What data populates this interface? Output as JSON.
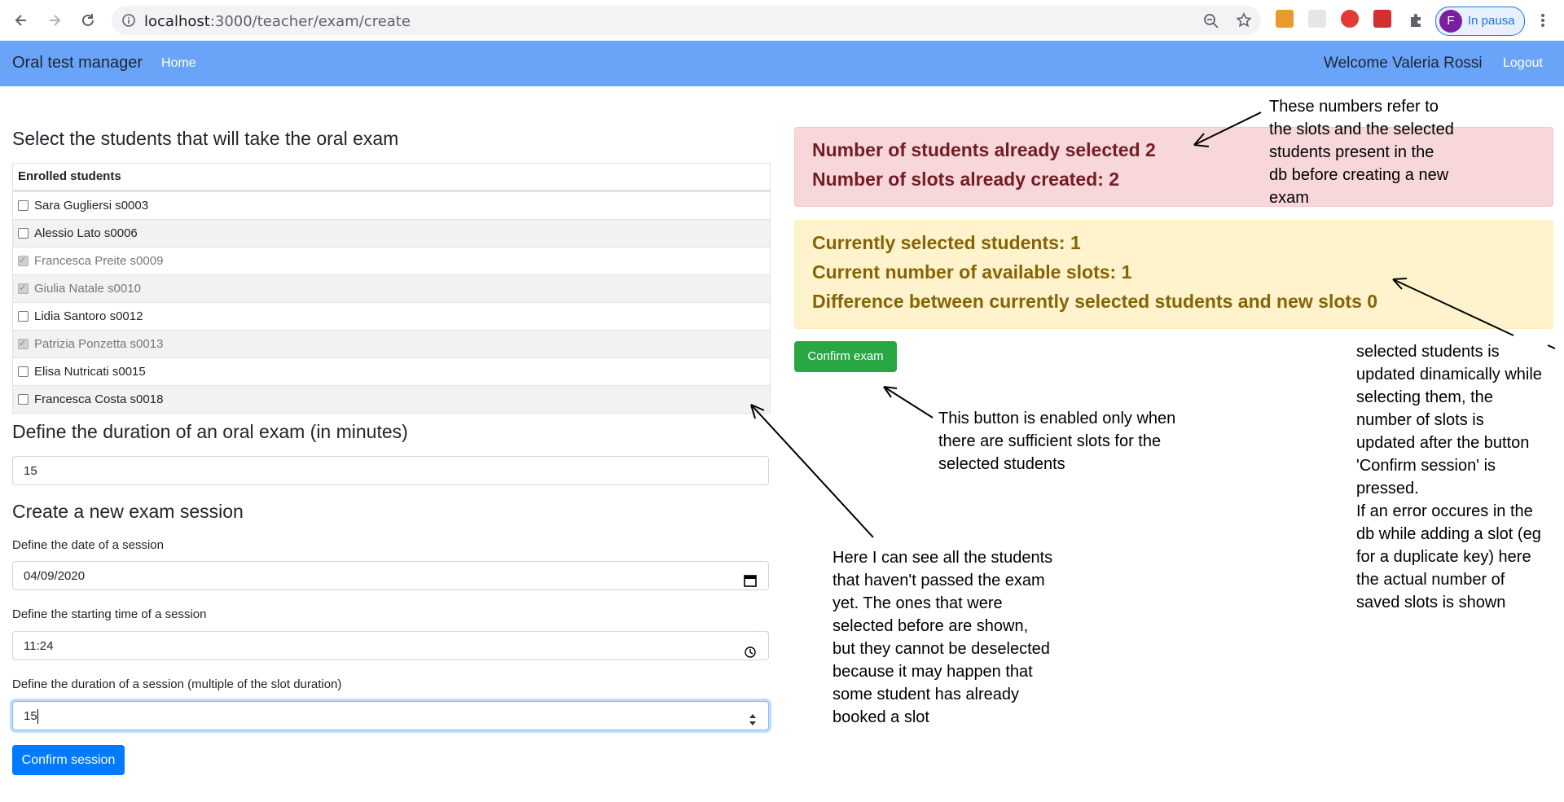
{
  "browser": {
    "url_host": "localhost",
    "url_path": ":3000/teacher/exam/create",
    "profile_initial": "F",
    "profile_label": "In pausa"
  },
  "navbar": {
    "brand": "Oral test manager",
    "home": "Home",
    "welcome": "Welcome Valeria Rossi",
    "logout": "Logout"
  },
  "students_section": {
    "title": "Select the students that will take the oral exam",
    "table_header": "Enrolled students",
    "students": [
      {
        "label": "Sara Gugliersi s0003",
        "checked": false,
        "disabled": false
      },
      {
        "label": "Alessio Lato s0006",
        "checked": false,
        "disabled": false
      },
      {
        "label": "Francesca Preite s0009",
        "checked": true,
        "disabled": true
      },
      {
        "label": "Giulia Natale s0010",
        "checked": true,
        "disabled": true
      },
      {
        "label": "Lidia Santoro s0012",
        "checked": false,
        "disabled": false
      },
      {
        "label": "Patrizia Ponzetta s0013",
        "checked": true,
        "disabled": true
      },
      {
        "label": "Elisa Nutricati s0015",
        "checked": false,
        "disabled": false
      },
      {
        "label": "Francesca Costa s0018",
        "checked": false,
        "disabled": false
      }
    ]
  },
  "duration_section": {
    "title": "Define the duration of an oral exam (in minutes)",
    "value": "15"
  },
  "session_section": {
    "title": "Create a new exam session",
    "date_label": "Define the date of a session",
    "date_value": "04/09/2020",
    "time_label": "Define the starting time of a session",
    "time_value": "11:24",
    "duration_label": "Define the duration of a session (multiple of the slot duration)",
    "duration_value": "15",
    "confirm_session": "Confirm session"
  },
  "summary": {
    "already_selected": "Number of students already selected 2",
    "already_slots": "Number of slots already created: 2",
    "currently_selected": "Currently selected students: 1",
    "available_slots": "Current number of available slots: 1",
    "difference": "Difference between currently selected students and new slots 0",
    "confirm_exam": "Confirm exam"
  },
  "annotations": {
    "db_note": "These numbers refer to\nthe slots and the selected\nstudents present in the\ndb before creating a new\nexam",
    "button_note": "This button is enabled only when\nthere are sufficient slots for the\nselected students",
    "students_note": "Here I can see all the students\nthat haven't passed the exam\nyet. The ones that were\nselected before are shown,\nbut they cannot be deselected\nbecause it may happen that\nsome student has already\nbooked a slot",
    "dynamic_note": "selected students is\nupdated dinamically while\nselecting them, the\nnumber of slots is\nupdated after the button\n'Confirm session' is\npressed.\nIf an error occures in the\ndb while adding a slot (eg\nfor a duplicate key) here\nthe actual number of\nsaved slots is shown"
  },
  "colors": {
    "navbar": "#6aa4f9",
    "primary": "#007bff",
    "success": "#28a745",
    "danger_bg": "#f8d7da",
    "warning_bg": "#fff3cd"
  }
}
